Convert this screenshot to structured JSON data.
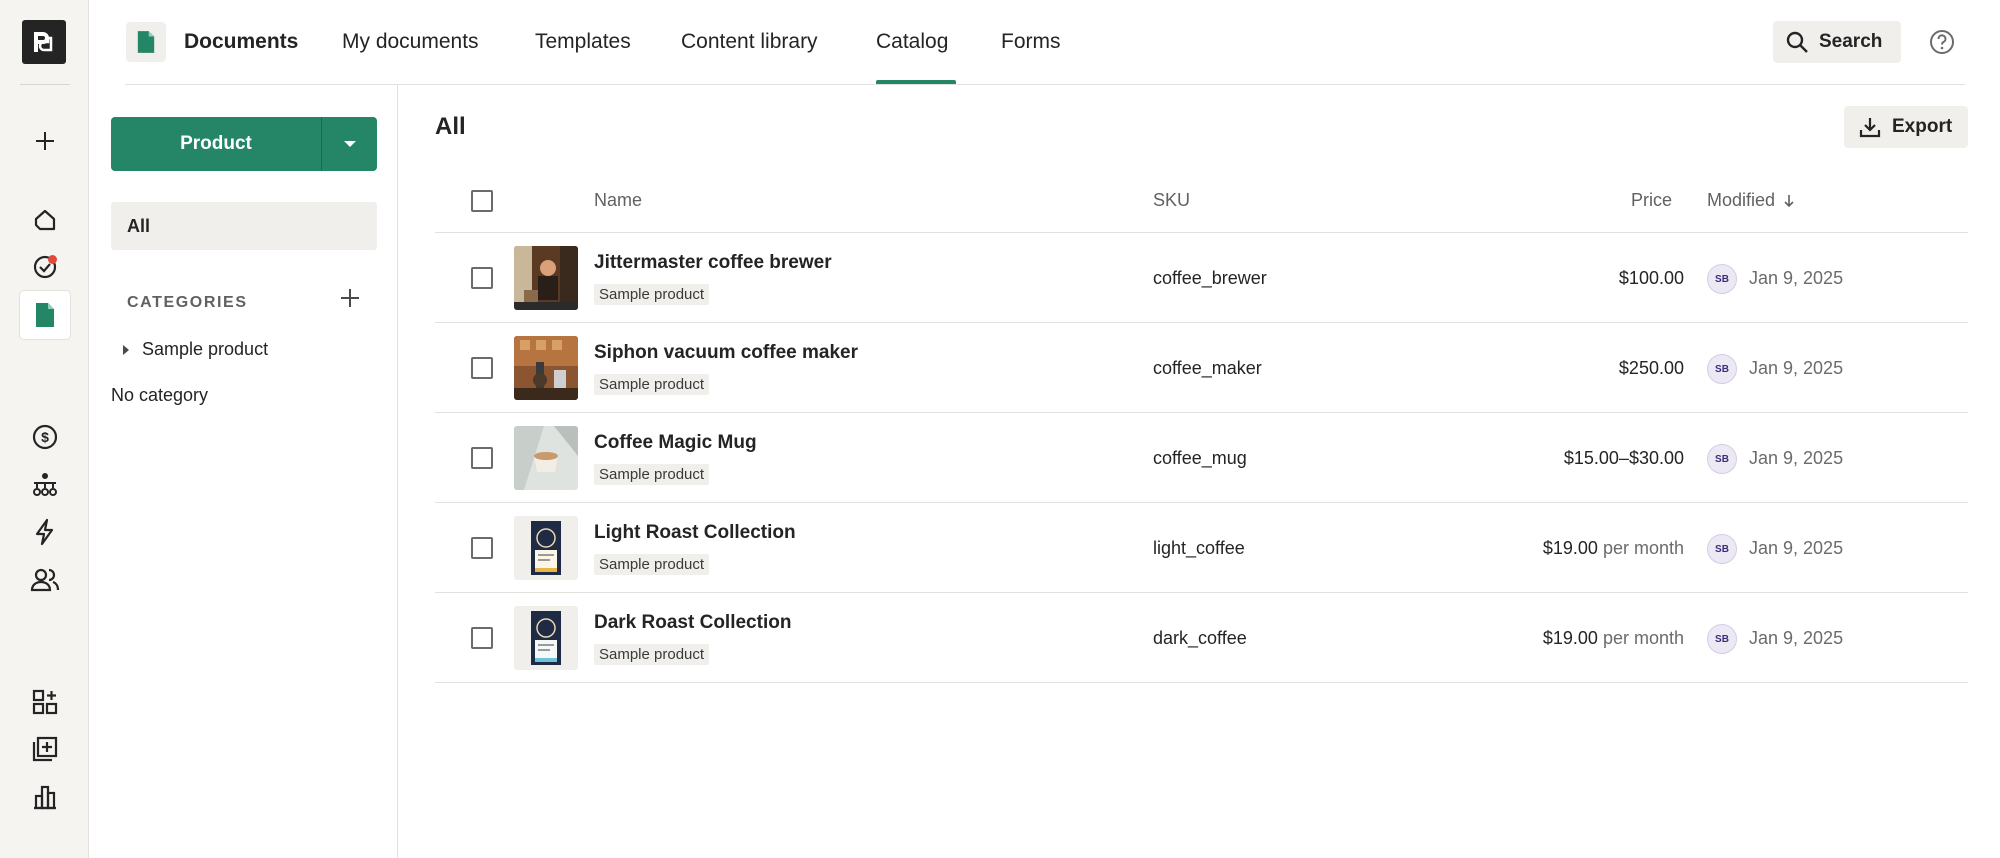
{
  "app": {
    "title": "Documents",
    "nav_tabs": [
      "My documents",
      "Templates",
      "Content library",
      "Catalog",
      "Forms"
    ],
    "active_tab": "Catalog",
    "search_label": "Search",
    "accent_color": "#248567"
  },
  "rail": {
    "icons": [
      "logo-icon",
      "plus-icon",
      "home-icon",
      "tasks-icon",
      "documents-icon",
      "dollar-icon",
      "workflow-icon",
      "bolt-icon",
      "contacts-icon",
      "widgets-icon",
      "add-library-icon",
      "reports-icon"
    ],
    "notification_dot_color": "#e0493b"
  },
  "sidepanel": {
    "product_button": "Product",
    "all_label": "All",
    "categories_heading": "CATEGORIES",
    "categories": [
      "Sample product"
    ],
    "no_category": "No category"
  },
  "main": {
    "title": "All",
    "export_label": "Export",
    "columns": {
      "name": "Name",
      "sku": "SKU",
      "price": "Price",
      "modified": "Modified"
    },
    "rows": [
      {
        "name": "Jittermaster coffee brewer",
        "tag": "Sample product",
        "sku": "coffee_brewer",
        "price": "$100.00",
        "unit": "",
        "avatar": "SB",
        "date": "Jan 9, 2025"
      },
      {
        "name": "Siphon vacuum coffee maker",
        "tag": "Sample product",
        "sku": "coffee_maker",
        "price": "$250.00",
        "unit": "",
        "avatar": "SB",
        "date": "Jan 9, 2025"
      },
      {
        "name": "Coffee Magic Mug",
        "tag": "Sample product",
        "sku": "coffee_mug",
        "price": "$15.00–$30.00",
        "unit": "",
        "avatar": "SB",
        "date": "Jan 9, 2025"
      },
      {
        "name": "Light Roast Collection",
        "tag": "Sample product",
        "sku": "light_coffee",
        "price": "$19.00",
        "unit": "per month",
        "avatar": "SB",
        "date": "Jan 9, 2025"
      },
      {
        "name": "Dark Roast Collection",
        "tag": "Sample product",
        "sku": "dark_coffee",
        "price": "$19.00",
        "unit": "per month",
        "avatar": "SB",
        "date": "Jan 9, 2025"
      }
    ]
  }
}
